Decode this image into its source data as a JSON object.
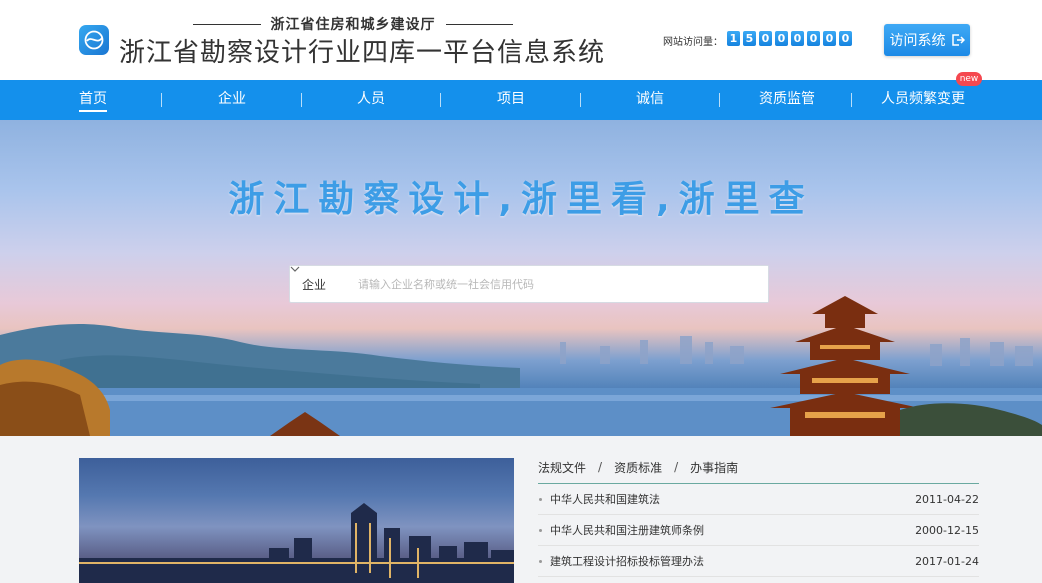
{
  "header": {
    "department": "浙江省住房和城乡建设厅",
    "system_title": "浙江省勘察设计行业四库一平台信息系统",
    "visit_label": "网站访问量：",
    "visit_digits": [
      "1",
      "5",
      "0",
      "0",
      "0",
      "0",
      "0",
      "0"
    ],
    "visit_button": "访问系统"
  },
  "nav": {
    "items": [
      "首页",
      "企业",
      "人员",
      "项目",
      "诚信",
      "资质监管",
      "人员频繁变更"
    ],
    "badge": "new"
  },
  "banner": {
    "slogan": "浙江勘察设计,浙里看,浙里查",
    "search": {
      "selected": "企业",
      "placeholder": "请输入企业名称或统一社会信用代码"
    }
  },
  "news": {
    "tabs": [
      "法规文件",
      "资质标准",
      "办事指南"
    ],
    "separator": "/",
    "rows": [
      {
        "title": "中华人民共和国建筑法",
        "date": "2011-04-22"
      },
      {
        "title": "中华人民共和国注册建筑师条例",
        "date": "2000-12-15"
      },
      {
        "title": "建筑工程设计招标投标管理办法",
        "date": "2017-01-24"
      }
    ]
  },
  "colors": {
    "nav_blue": "#1490ec",
    "slogan_blue": "#3d9de6",
    "badge_red": "#f5484f"
  },
  "icons": [
    "logo-icon",
    "chevron-down-icon",
    "exit-arrow-icon"
  ]
}
